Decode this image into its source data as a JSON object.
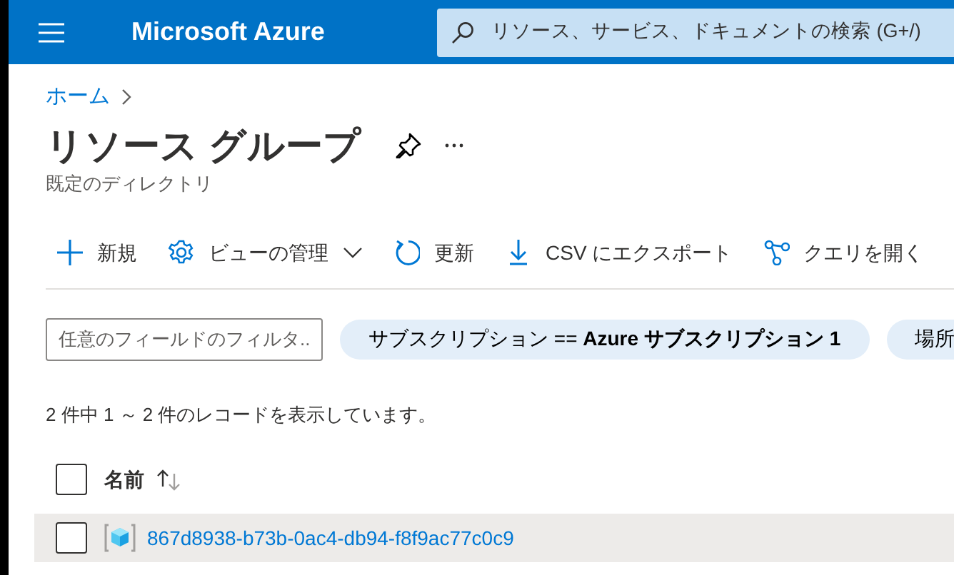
{
  "header": {
    "title": "Microsoft Azure",
    "search": {
      "placeholder": "リソース、サービス、ドキュメントの検索 (G+/)"
    }
  },
  "breadcrumb": [
    {
      "label": "ホーム"
    }
  ],
  "page": {
    "title": "リソース グループ",
    "subtitle": "既定のディレクトリ"
  },
  "toolbar": [
    {
      "kind": "add",
      "label": "新規",
      "dropdown": false
    },
    {
      "kind": "settings",
      "label": "ビューの管理",
      "dropdown": true
    },
    {
      "kind": "refresh",
      "label": "更新",
      "dropdown": false
    },
    {
      "kind": "download",
      "label": "CSV にエクスポート",
      "dropdown": false
    },
    {
      "kind": "query",
      "label": "クエリを開く",
      "dropdown": false
    }
  ],
  "filter": {
    "placeholder": "任意のフィールドのフィルタ..."
  },
  "filter_pills": [
    {
      "text": "サブスクリプション == **Azure サブスクリプション 1**"
    },
    {
      "text": "場所"
    }
  ],
  "record_count": "2 件中 1 ～ 2 件のレコードを表示しています。",
  "table": {
    "header_checked": false,
    "columns": [
      {
        "label": "名前",
        "sorted_ascending": true
      }
    ],
    "rows": [
      {
        "name": "867d8938-b73b-0ac4-db94-f8f9ac77c0c9",
        "checked": false,
        "selected": true
      }
    ]
  }
}
